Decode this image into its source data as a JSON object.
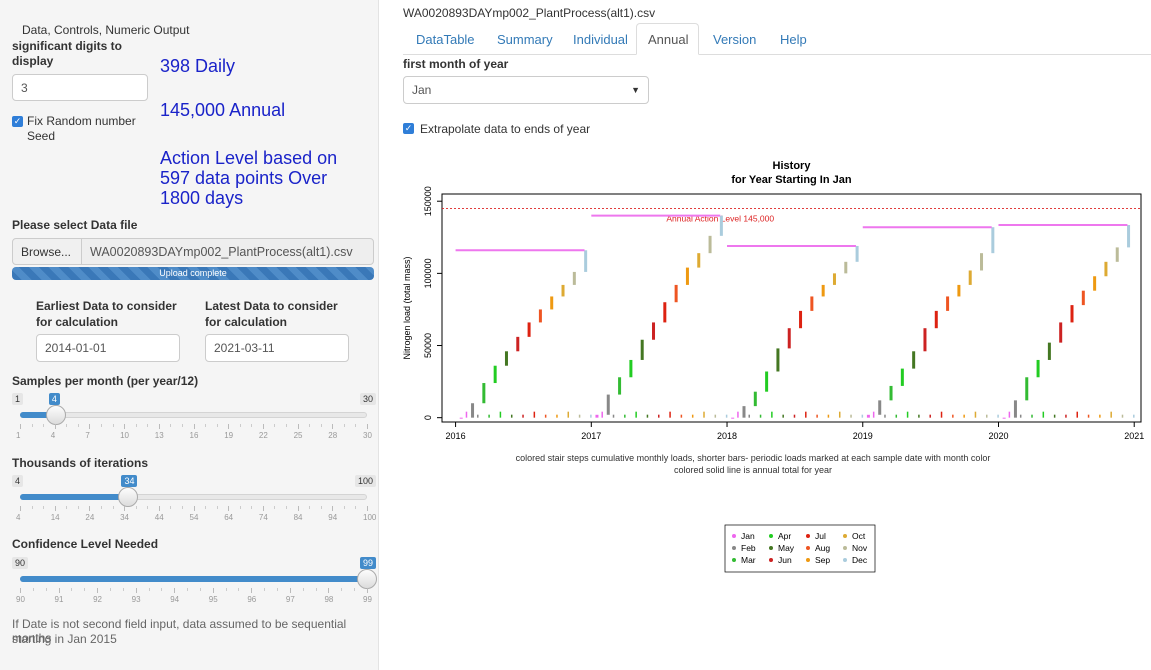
{
  "sidebar": {
    "heading": "Data, Controls, Numeric Output",
    "sig_digits_label_line1": "significant digits to",
    "sig_digits_label_line2": "display",
    "sig_digits_value": "3",
    "fix_seed_label_line1": "Fix Random number",
    "fix_seed_label_line2": "Seed",
    "fix_seed_checked": true,
    "output_daily": "398 Daily",
    "output_annual": "145,000 Annual",
    "output_action_line1": "Action Level based on",
    "output_action_line2": "597 data points Over",
    "output_action_line3": "1800 days",
    "file_label": "Please select Data file",
    "browse_label": "Browse...",
    "file_name": "WA0020893DAYmp002_PlantProcess(alt1).csv",
    "upload_status": "Upload complete",
    "earliest_label_line1": "Earliest Data to consider",
    "earliest_label_line2": "for calculation",
    "earliest_value": "2014-01-01",
    "latest_label_line1": "Latest Data to consider",
    "latest_label_line2": "for calculation",
    "latest_value": "2021-03-11",
    "samples_slider": {
      "label": "Samples per month (per year/12)",
      "min": "1",
      "max": "30",
      "value": "4",
      "fraction": 0.1034,
      "ticks": [
        "1",
        "4",
        "7",
        "10",
        "13",
        "16",
        "19",
        "22",
        "25",
        "28",
        "30"
      ]
    },
    "iterations_slider": {
      "label": "Thousands of iterations",
      "min": "4",
      "max": "100",
      "value": "34",
      "fraction": 0.3125,
      "ticks": [
        "4",
        "14",
        "24",
        "34",
        "44",
        "54",
        "64",
        "74",
        "84",
        "94",
        "100"
      ]
    },
    "confidence_slider": {
      "label": "Confidence Level Needed",
      "min": "90",
      "max": "99",
      "value": "99",
      "fraction": 1.0,
      "ticks": [
        "90",
        "91",
        "92",
        "93",
        "94",
        "95",
        "96",
        "97",
        "98",
        "99"
      ]
    },
    "note_line1": "If Date is not second field input, data assumed to be sequential months",
    "note_line2": "starting in Jan 2015"
  },
  "main": {
    "file_title": "WA0020893DAYmp002_PlantProcess(alt1).csv",
    "tabs": [
      {
        "label": "DataTable",
        "active": false
      },
      {
        "label": "Summary",
        "active": false
      },
      {
        "label": "Individual",
        "active": false
      },
      {
        "label": "Annual",
        "active": true
      },
      {
        "label": "Version",
        "active": false
      },
      {
        "label": "Help",
        "active": false
      }
    ],
    "first_month_label": "first month of year",
    "first_month_value": "Jan",
    "extrapolate_label": "Extrapolate data to ends of year",
    "extrapolate_checked": true,
    "caption_line1": "colored stair steps cumulative monthly loads, shorter bars- periodic loads marked at each sample date with month color",
    "caption_line2": "colored solid line is annual total for year"
  },
  "chart_data": {
    "type": "bar",
    "title_line1": "History",
    "title_line2": "for Year Starting In  Jan",
    "ylabel": "Nitrogen load (total mass)",
    "xlabel": "",
    "xlim": [
      2015.9,
      2021.05
    ],
    "ylim": [
      -3000,
      155000
    ],
    "x_ticks": [
      "2016",
      "2017",
      "2018",
      "2019",
      "2020",
      "2021"
    ],
    "y_ticks": [
      "0",
      "50000",
      "100000",
      "150000"
    ],
    "action_level": 145000,
    "action_level_label": "Annual Action Level 145,000",
    "annual_totals": [
      {
        "year": 2016,
        "total": 116000
      },
      {
        "year": 2017,
        "total": 140000
      },
      {
        "year": 2018,
        "total": 119000
      },
      {
        "year": 2019,
        "total": 132000
      },
      {
        "year": 2020,
        "total": 133500
      }
    ],
    "monthly_cumulative": {
      "2016": [
        0,
        10000,
        24000,
        36000,
        46000,
        56000,
        66000,
        75000,
        84000,
        92000,
        101000,
        116000
      ],
      "2017": [
        2000,
        16000,
        28000,
        40000,
        54000,
        66000,
        80000,
        92000,
        104000,
        114000,
        126000,
        140000
      ],
      "2018": [
        0,
        8000,
        18000,
        32000,
        48000,
        62000,
        74000,
        84000,
        92000,
        100000,
        108000,
        119000
      ],
      "2019": [
        2000,
        12000,
        22000,
        34000,
        46000,
        62000,
        74000,
        84000,
        92000,
        102000,
        114000,
        132000
      ],
      "2020": [
        0,
        12000,
        28000,
        40000,
        52000,
        66000,
        78000,
        88000,
        98000,
        108000,
        118000,
        133500
      ]
    },
    "legend": [
      {
        "name": "Jan",
        "color": "#ee66ee"
      },
      {
        "name": "Feb",
        "color": "#888888"
      },
      {
        "name": "Mar",
        "color": "#33bb33"
      },
      {
        "name": "Apr",
        "color": "#22cc22"
      },
      {
        "name": "May",
        "color": "#447722"
      },
      {
        "name": "Jun",
        "color": "#cc2222"
      },
      {
        "name": "Jul",
        "color": "#dd2211"
      },
      {
        "name": "Aug",
        "color": "#ee5522"
      },
      {
        "name": "Sep",
        "color": "#ee9911"
      },
      {
        "name": "Oct",
        "color": "#ddaa33"
      },
      {
        "name": "Nov",
        "color": "#bbbb99"
      },
      {
        "name": "Dec",
        "color": "#aaccdd"
      }
    ],
    "annual_line_color": "#ee77ee",
    "action_line_color": "#dd2222"
  }
}
